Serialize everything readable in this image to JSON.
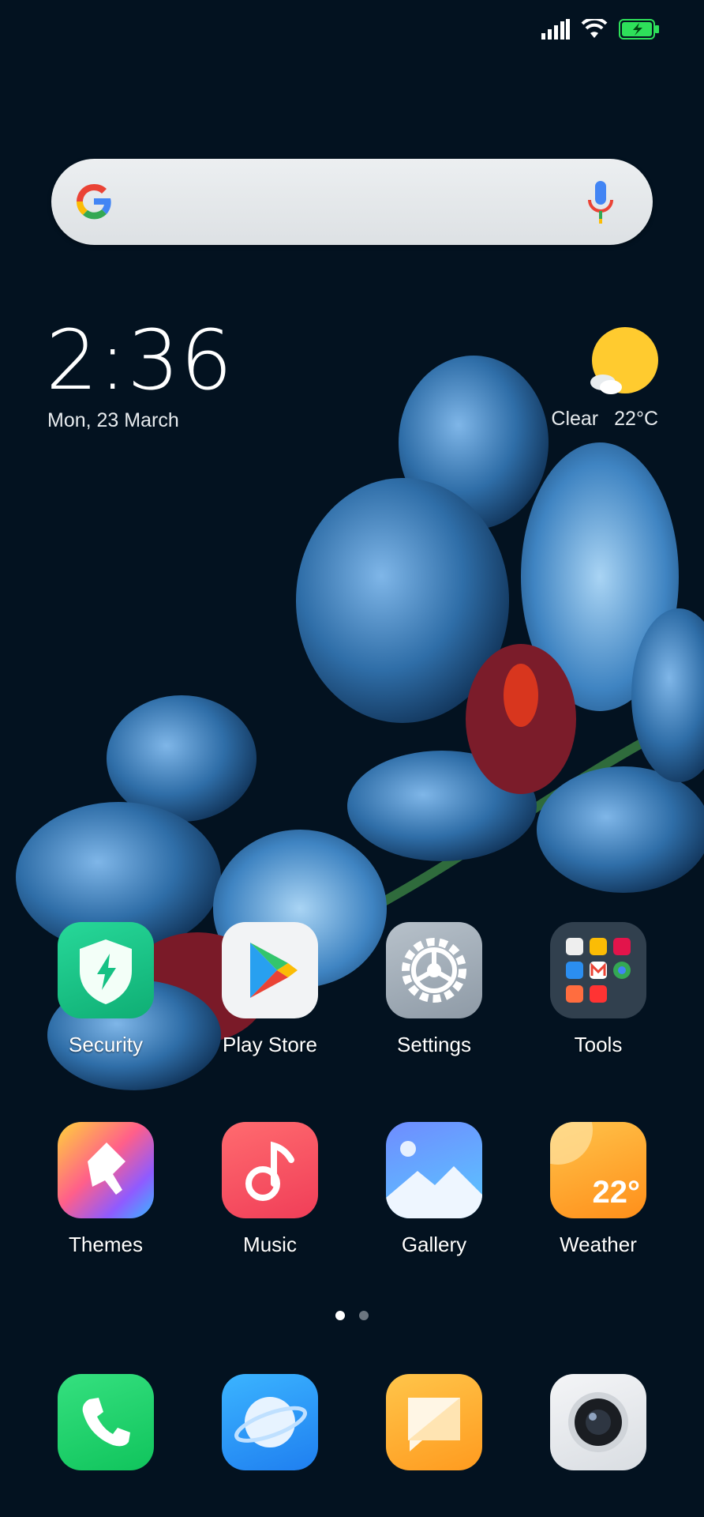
{
  "status_bar": {
    "icons": [
      "signal-icon",
      "wifi-icon",
      "battery-charging-icon"
    ]
  },
  "search": {
    "logo": "google-icon",
    "mic": "mic-icon"
  },
  "clock": {
    "time": "2:36",
    "date": "Mon, 23 March"
  },
  "weather_widget": {
    "icon": "sun-cloud-icon",
    "condition": "Clear",
    "temperature": "22°C"
  },
  "home": {
    "row1": [
      {
        "label": "Security",
        "icon": "security-shield-icon"
      },
      {
        "label": "Play Store",
        "icon": "play-store-icon"
      },
      {
        "label": "Settings",
        "icon": "gear-icon"
      },
      {
        "label": "Tools",
        "icon": "folder-icon"
      }
    ],
    "row2": [
      {
        "label": "Themes",
        "icon": "brush-icon"
      },
      {
        "label": "Music",
        "icon": "music-note-icon"
      },
      {
        "label": "Gallery",
        "icon": "gallery-icon"
      },
      {
        "label": "Weather",
        "icon": "weather-icon",
        "badge": "22°"
      }
    ]
  },
  "page_indicator": {
    "pages": 2,
    "active": 1
  },
  "dock": [
    {
      "icon": "phone-icon"
    },
    {
      "icon": "browser-icon"
    },
    {
      "icon": "messages-icon"
    },
    {
      "icon": "camera-icon"
    }
  ],
  "colors": {
    "background": "#031220",
    "security": "#15c184",
    "music": "#f25463",
    "weather": "#ffa21b",
    "phone": "#1ed66e",
    "browser": "#2b9cf8",
    "messages": "#ffb02e"
  }
}
